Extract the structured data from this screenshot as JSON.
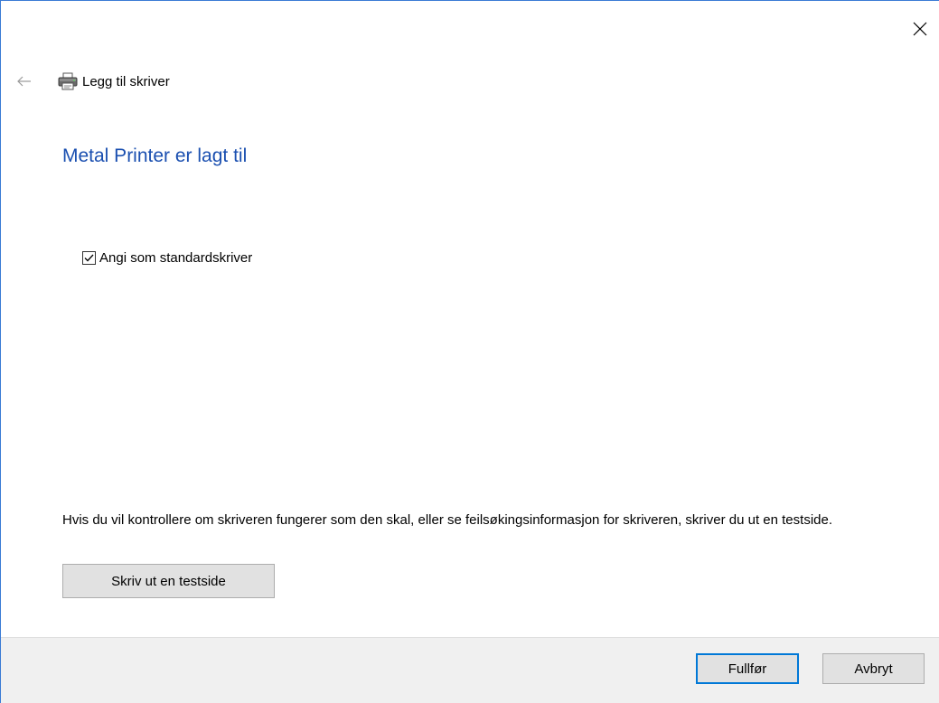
{
  "window": {
    "title": "Legg til skriver",
    "close_icon": "close-icon",
    "back_icon": "back-arrow-icon",
    "printer_icon": "printer-icon"
  },
  "main": {
    "heading": "Metal Printer er lagt til",
    "heading_color": "#1a4fb0",
    "default_printer_checkbox": {
      "label": "Angi som standardskriver",
      "checked": true
    },
    "info_text": "Hvis du vil kontrollere om skriveren fungerer som den skal, eller se feilsøkingsinformasjon for skriveren, skriver du ut en testside.",
    "test_page_button": "Skriv ut en testside"
  },
  "footer": {
    "finish_button": "Fullfør",
    "cancel_button": "Avbryt",
    "accent_color": "#0078d7"
  }
}
